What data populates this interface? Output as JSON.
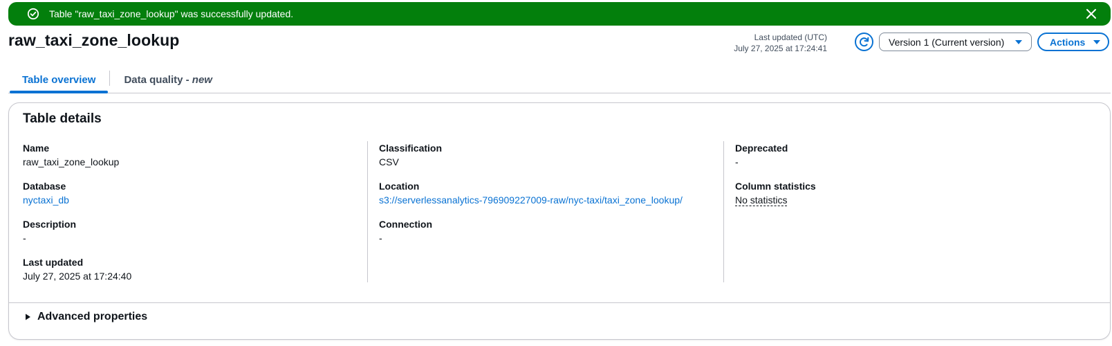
{
  "flash": {
    "message": "Table \"raw_taxi_zone_lookup\" was successfully updated.",
    "icon": "check-circle-icon",
    "color": "#037f0c"
  },
  "header": {
    "title": "raw_taxi_zone_lookup",
    "last_updated_label": "Last updated (UTC)",
    "last_updated_value": "July 27, 2025 at 17:24:41",
    "version_selected": "Version 1 (Current version)",
    "actions_label": "Actions"
  },
  "tabs": [
    {
      "label": "Table overview",
      "active": true
    },
    {
      "label": "Data quality - ",
      "suffix": "new",
      "active": false
    }
  ],
  "details": {
    "title": "Table details",
    "col1": [
      {
        "label": "Name",
        "value": "raw_taxi_zone_lookup"
      },
      {
        "label": "Database",
        "value": "nyctaxi_db"
      },
      {
        "label": "Description",
        "value": "-"
      },
      {
        "label": "Last updated",
        "value": "July 27, 2025 at 17:24:40"
      }
    ],
    "col2": [
      {
        "label": "Classification",
        "value": "CSV"
      },
      {
        "label": "Location",
        "value": "s3://serverlessanalytics-796909227009-raw/nyc-taxi/taxi_zone_lookup/"
      },
      {
        "label": "Connection",
        "value": "-"
      }
    ],
    "col3": [
      {
        "label": "Deprecated",
        "value": "-"
      },
      {
        "label": "Column statistics",
        "value": "No statistics"
      }
    ],
    "advanced_label": "Advanced properties"
  },
  "colors": {
    "accent": "#0972d3",
    "success": "#037f0c",
    "text": "#0f141a",
    "border": "#c6c6cd"
  }
}
